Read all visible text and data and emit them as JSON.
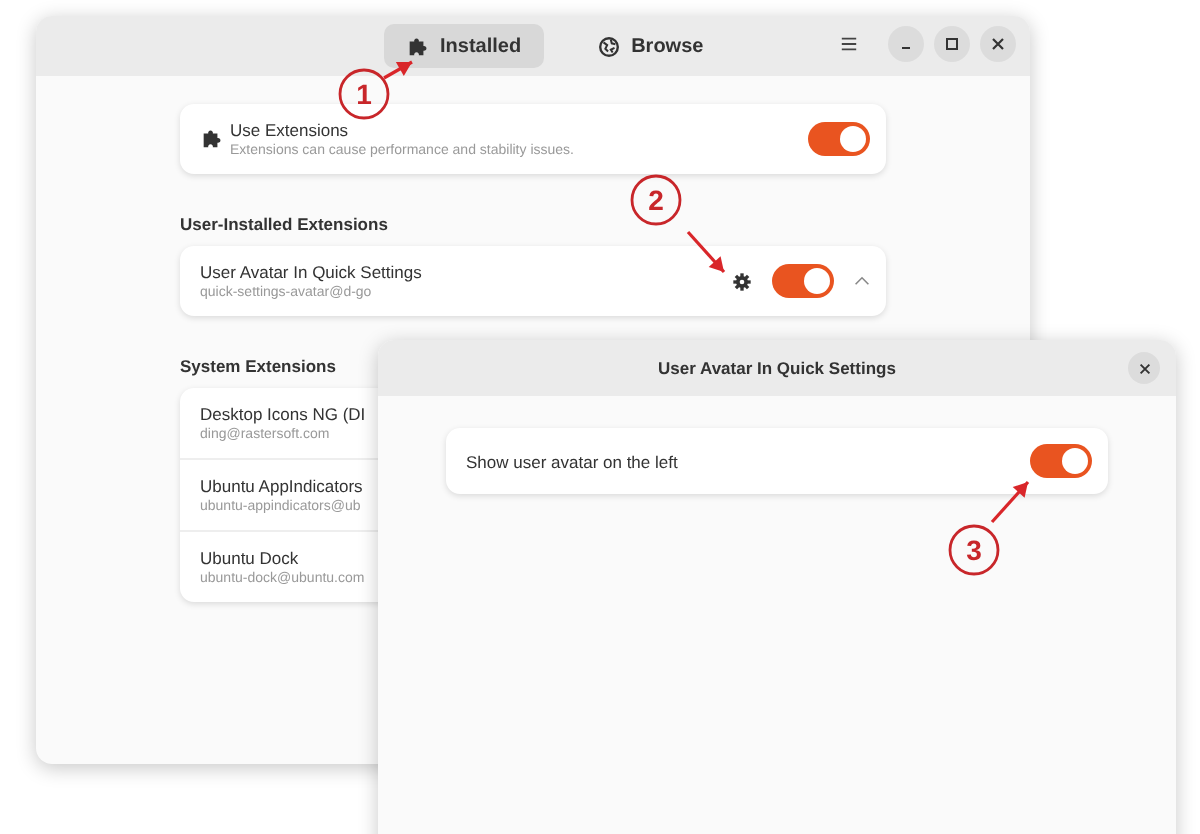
{
  "main_window": {
    "tabs": [
      {
        "label": "Installed",
        "selected": true
      },
      {
        "label": "Browse",
        "selected": false
      }
    ],
    "master_switch": {
      "title": "Use Extensions",
      "subtitle": "Extensions can cause performance and stability issues.",
      "on": true
    },
    "user_extensions": {
      "heading": "User-Installed Extensions",
      "items": [
        {
          "name": "User Avatar In Quick Settings",
          "id": "quick-settings-avatar@d-go",
          "on": true
        }
      ]
    },
    "system_extensions": {
      "heading": "System Extensions",
      "items": [
        {
          "name": "Desktop Icons NG (DI",
          "id": "ding@rastersoft.com"
        },
        {
          "name": "Ubuntu AppIndicators",
          "id": "ubuntu-appindicators@ub"
        },
        {
          "name": "Ubuntu Dock",
          "id": "ubuntu-dock@ubuntu.com"
        }
      ]
    }
  },
  "dialog": {
    "title": "User Avatar In Quick Settings",
    "options": [
      {
        "label": "Show user avatar on the left",
        "on": true
      }
    ]
  },
  "callouts": [
    {
      "number": "1"
    },
    {
      "number": "2"
    },
    {
      "number": "3"
    }
  ]
}
